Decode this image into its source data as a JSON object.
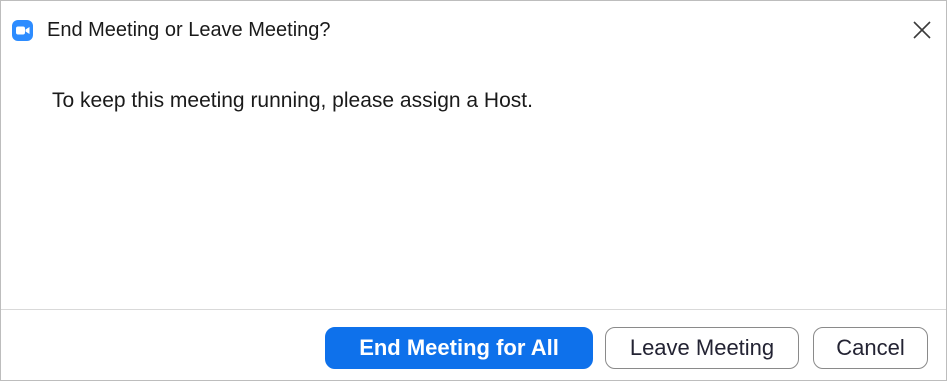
{
  "window": {
    "title": "End Meeting or Leave Meeting?",
    "app_icon": "zoom-camera-icon",
    "close_icon": "close-icon"
  },
  "dialog": {
    "message": "To keep this meeting running, please assign a Host."
  },
  "buttons": {
    "end_for_all": "End Meeting for All",
    "leave": "Leave Meeting",
    "cancel": "Cancel"
  },
  "colors": {
    "brand_blue": "#2d8cff",
    "primary_button": "#0e71eb",
    "text": "#1a1a1a",
    "border": "#8a8a8a"
  }
}
